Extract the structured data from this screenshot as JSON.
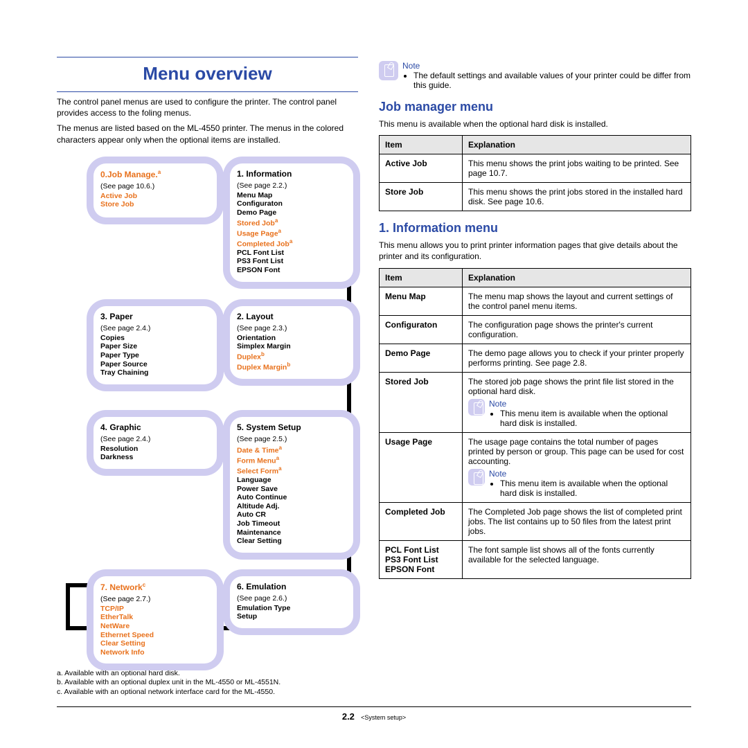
{
  "header": {
    "title": "Menu overview"
  },
  "intro": {
    "p1": "The control panel menus are used to configure the printer. The control panel provides access to the foling menus.",
    "p2": "The menus are listed based on the ML-4550 printer. The menus in the colored characters appear only when the optional items are installed."
  },
  "menu_boxes": {
    "b0": {
      "title": "0.Job Manage.",
      "tsup": "a",
      "seepage": "(See page 10.6.)",
      "items": [
        {
          "t": "Active Job",
          "c": "orange"
        },
        {
          "t": "Store Job",
          "c": "orange"
        }
      ]
    },
    "b1": {
      "title": "1. Information",
      "seepage": "(See page 2.2.)",
      "items": [
        {
          "t": "Menu Map",
          "c": "bold"
        },
        {
          "t": "Configuraton",
          "c": "bold"
        },
        {
          "t": "Demo Page",
          "c": "bold"
        },
        {
          "t": "Stored Job",
          "c": "orange",
          "sup": "a"
        },
        {
          "t": "Usage Page",
          "c": "orange",
          "sup": "a"
        },
        {
          "t": "Completed Job",
          "c": "orange",
          "sup": "a"
        },
        {
          "t": "PCL Font List",
          "c": "bold"
        },
        {
          "t": "PS3 Font List",
          "c": "bold"
        },
        {
          "t": "EPSON Font",
          "c": "bold"
        }
      ]
    },
    "b3": {
      "title": "3. Paper",
      "seepage": "(See page 2.4.)",
      "items": [
        {
          "t": "Copies",
          "c": "bold"
        },
        {
          "t": "Paper Size",
          "c": "bold"
        },
        {
          "t": "Paper Type",
          "c": "bold"
        },
        {
          "t": "Paper Source",
          "c": "bold"
        },
        {
          "t": "Tray Chaining",
          "c": "bold"
        }
      ]
    },
    "b2": {
      "title": "2. Layout",
      "seepage": "(See page 2.3.)",
      "items": [
        {
          "t": "Orientation",
          "c": "bold"
        },
        {
          "t": "Simplex Margin",
          "c": "bold"
        },
        {
          "t": "Duplex",
          "c": "orange",
          "sup": "b"
        },
        {
          "t": "Duplex Margin",
          "c": "orange",
          "sup": "b"
        }
      ]
    },
    "b4": {
      "title": "4. Graphic",
      "seepage": "(See page 2.4.)",
      "items": [
        {
          "t": "Resolution",
          "c": "bold"
        },
        {
          "t": "Darkness",
          "c": "bold"
        }
      ]
    },
    "b5": {
      "title": "5. System Setup",
      "seepage": "(See page 2.5.)",
      "items": [
        {
          "t": "Date & Time",
          "c": "orange",
          "sup": "a"
        },
        {
          "t": "Form Menu",
          "c": "orange",
          "sup": "a"
        },
        {
          "t": "Select Form",
          "c": "orange",
          "sup": "a"
        },
        {
          "t": "Language",
          "c": "bold"
        },
        {
          "t": "Power Save",
          "c": "bold"
        },
        {
          "t": "Auto Continue",
          "c": "bold"
        },
        {
          "t": "Altitude Adj.",
          "c": "bold"
        },
        {
          "t": "Auto CR",
          "c": "bold"
        },
        {
          "t": "Job Timeout",
          "c": "bold"
        },
        {
          "t": "Maintenance",
          "c": "bold"
        },
        {
          "t": "Clear Setting",
          "c": "bold"
        }
      ]
    },
    "b7": {
      "title": "7. Network",
      "tsup": "c",
      "seepage": "(See page 2.7.)",
      "items": [
        {
          "t": "TCP/IP",
          "c": "orange"
        },
        {
          "t": "EtherTalk",
          "c": "orange"
        },
        {
          "t": "NetWare",
          "c": "orange"
        },
        {
          "t": "Ethernet Speed",
          "c": "orange"
        },
        {
          "t": "Clear Setting",
          "c": "orange"
        },
        {
          "t": "Network Info",
          "c": "orange"
        }
      ]
    },
    "b6": {
      "title": "6. Emulation",
      "seepage": "(See page 2.6.)",
      "items": [
        {
          "t": "Emulation Type",
          "c": "bold"
        },
        {
          "t": "Setup",
          "c": "bold"
        }
      ]
    }
  },
  "footnotes": {
    "a": "a. Available with an optional hard disk.",
    "b": "b. Available with an optional duplex unit in the ML-4550 or ML-4551N.",
    "c": "c. Available with an optional network interface card for the ML-4550."
  },
  "right": {
    "note1_label": "Note",
    "note1_text": "The default settings and available values of your printer could be differ from this guide.",
    "job_manager": {
      "heading": "Job manager menu",
      "intro": "This menu is available when the optional hard disk is installed.",
      "table": {
        "headers": {
          "item": "Item",
          "exp": "Explanation"
        },
        "rows": [
          {
            "item": "Active Job",
            "exp": "This menu shows the print jobs waiting to be printed. See page 10.7."
          },
          {
            "item": "Store Job",
            "exp": "This menu shows the print jobs stored in the installed hard disk. See page 10.6."
          }
        ]
      }
    },
    "info": {
      "heading": "1. Information menu",
      "intro": "This menu allows you to print printer information pages that give details about the printer and its configuration.",
      "table": {
        "headers": {
          "item": "Item",
          "exp": "Explanation"
        },
        "rows": [
          {
            "item": "Menu Map",
            "exp": "The menu map shows the layout and current settings of the control panel menu items."
          },
          {
            "item": "Configuraton",
            "exp": "The configuration page shows the printer's current configuration."
          },
          {
            "item": "Demo Page",
            "exp": "The demo page allows you to check if your printer properly performs printing. See page 2.8."
          },
          {
            "item": "Stored Job",
            "exp": "The stored job page shows the print file list stored in the optional hard disk.",
            "note_label": "Note",
            "note_text": "This menu item is available when the optional hard disk is installed."
          },
          {
            "item": "Usage Page",
            "exp": "The usage page contains the total number of pages printed by person or group. This page can be used for cost accounting.",
            "note_label": "Note",
            "note_text": "This menu item is available when the optional hard disk is installed."
          },
          {
            "item": "Completed Job",
            "exp": "The Completed Job page shows the list of completed print jobs. The list contains up to 50 files from the latest print jobs."
          },
          {
            "item": "PCL Font List\nPS3 Font List\nEPSON Font",
            "exp": "The font sample list shows all of the fonts currently available for the selected language."
          }
        ]
      }
    }
  },
  "footer": {
    "pagenum": "2.2",
    "section": "<System setup>"
  }
}
